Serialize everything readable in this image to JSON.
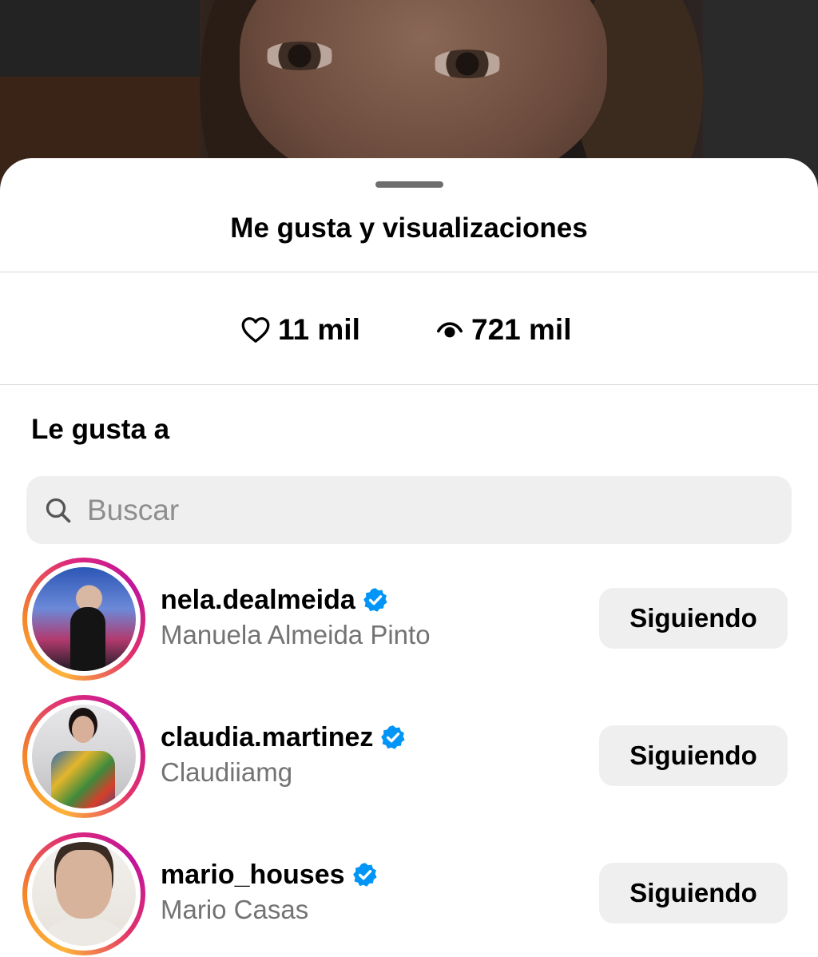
{
  "sheet": {
    "title": "Me gusta y visualizaciones"
  },
  "stats": {
    "likes_count": "11 mil",
    "likes_icon": "heart-outline-icon",
    "views_count": "721 mil",
    "views_icon": "eye-icon"
  },
  "likes_section": {
    "title": "Le gusta a"
  },
  "search": {
    "placeholder": "Buscar",
    "value": "",
    "icon": "search-icon"
  },
  "users": [
    {
      "username": "nela.dealmeida",
      "full_name": "Manuela Almeida Pinto",
      "verified": true,
      "button_label": "Siguiendo"
    },
    {
      "username": "claudia.martinez",
      "full_name": "Claudiiamg",
      "verified": true,
      "button_label": "Siguiendo"
    },
    {
      "username": "mario_houses",
      "full_name": "Mario Casas",
      "verified": true,
      "button_label": "Siguiendo"
    }
  ],
  "colors": {
    "verified_badge": "#0095f6",
    "button_bg": "#efefef",
    "secondary_text": "#737373",
    "story_ring_start": "#fdb43a",
    "story_ring_end": "#c0149c"
  }
}
